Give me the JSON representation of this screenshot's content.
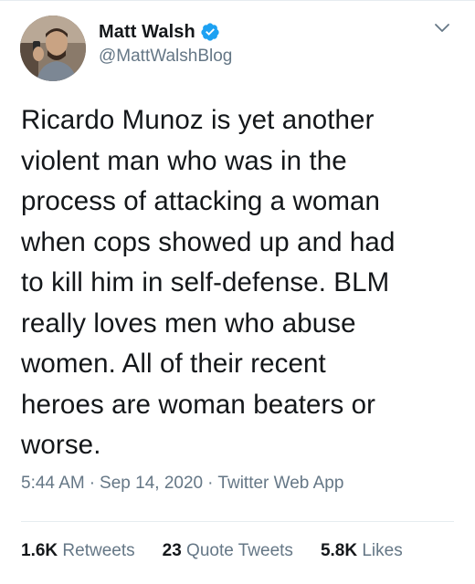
{
  "author": {
    "display_name": "Matt Walsh",
    "handle": "@MattWalshBlog",
    "verified": true
  },
  "tweet": {
    "text": "Ricardo Munoz is yet another\nviolent man who was in the\nprocess of attacking a woman\nwhen cops showed up and had\nto kill him in self-defense. BLM\nreally loves men who abuse\nwomen. All of their recent\nheroes are woman beaters or\nworse."
  },
  "meta": {
    "time": "5:44 AM",
    "date": "Sep 14, 2020",
    "source": "Twitter Web App",
    "separator": "·"
  },
  "stats": {
    "retweets_count": "1.6K",
    "retweets_label": "Retweets",
    "quotes_count": "23",
    "quotes_label": "Quote Tweets",
    "likes_count": "5.8K",
    "likes_label": "Likes"
  },
  "icons": {
    "verified": "verified-badge-icon",
    "caret": "chevron-down-icon"
  },
  "colors": {
    "text_primary": "#14171a",
    "text_secondary": "#657786",
    "verified_blue": "#1da1f2",
    "divider": "#e6ecf0",
    "background": "#ffffff"
  }
}
